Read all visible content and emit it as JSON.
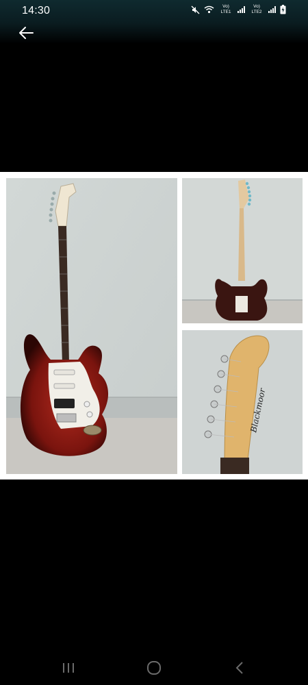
{
  "status_bar": {
    "time": "14:30",
    "sim1_label": "Vo) LTE1",
    "sim2_label": "Vo) LTE2",
    "icons": [
      "mute-icon",
      "wifi-icon",
      "signal-icon",
      "battery-charging-icon"
    ]
  },
  "toolbar": {
    "back_icon": "arrow-left-icon"
  },
  "gallery": {
    "images": [
      {
        "description": "red sunburst electric guitar front"
      },
      {
        "description": "guitar back view"
      },
      {
        "description": "guitar headstock close-up"
      }
    ],
    "headstock_brand": "Blackmoor"
  },
  "nav_bar": {
    "icons": [
      "recent-apps-icon",
      "home-icon",
      "back-icon"
    ]
  },
  "colors": {
    "background": "#000000",
    "status_bar": "#0f2a2f",
    "collage_border": "#ffffff"
  }
}
